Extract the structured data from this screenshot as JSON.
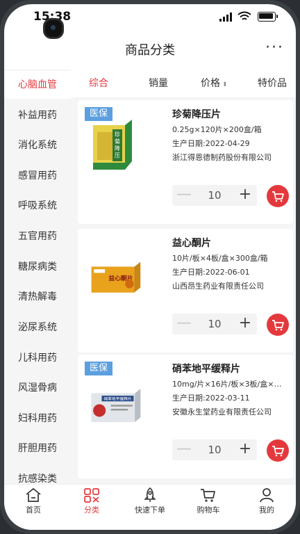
{
  "status_bar": {
    "time": "15:38"
  },
  "header": {
    "title": "商品分类",
    "more_label": "···"
  },
  "sidebar": {
    "items": [
      {
        "label": "心脑血管",
        "active": true
      },
      {
        "label": "补益用药"
      },
      {
        "label": "消化系统"
      },
      {
        "label": "感冒用药"
      },
      {
        "label": "呼吸系统"
      },
      {
        "label": "五官用药"
      },
      {
        "label": "糖尿病类"
      },
      {
        "label": "清热解毒"
      },
      {
        "label": "泌尿系统"
      },
      {
        "label": "儿科用药"
      },
      {
        "label": "风湿骨病"
      },
      {
        "label": "妇科用药"
      },
      {
        "label": "肝胆用药"
      },
      {
        "label": "抗感染类"
      }
    ]
  },
  "sort_bar": {
    "comprehensive": "综合",
    "sales": "销量",
    "price": "价格",
    "price_arrows": "⬍",
    "special": "特价品"
  },
  "products": [
    {
      "tag": "医保",
      "name": "珍菊降压片",
      "spec": "0.25g×120片×200盒/箱",
      "date": "生产日期:2022-04-29",
      "maker": "浙江得恩德制药股份有限公司",
      "qty": "10",
      "box_text": "珍菊降压片",
      "box_color": "#e7d24a"
    },
    {
      "tag": "",
      "name": "益心酮片",
      "spec": "10片/板×4板/盒×300盒/箱",
      "date": "生产日期:2022-06-01",
      "maker": "山西昂生药业有限责任公司",
      "qty": "10",
      "box_text": "益心酮片",
      "box_color": "#e8a21c"
    },
    {
      "tag": "医保",
      "name": "硝苯地平缓释片",
      "spec": "10mg/片×16片/板×3板/盒×3...",
      "date": "生产日期:2022-03-11",
      "maker": "安徽永生堂药业有限责任公司",
      "qty": "10",
      "box_text": "硝苯地平缓释片",
      "box_color": "#d9dde3"
    }
  ],
  "stepper": {
    "minus": "—",
    "plus": "+"
  },
  "tabbar": {
    "items": [
      {
        "label": "首页",
        "icon": "home-icon"
      },
      {
        "label": "分类",
        "icon": "category-icon",
        "active": true
      },
      {
        "label": "快速下单",
        "icon": "rocket-icon"
      },
      {
        "label": "购物车",
        "icon": "cart-icon"
      },
      {
        "label": "我的",
        "icon": "user-icon"
      }
    ]
  },
  "colors": {
    "accent": "#e4393c",
    "tag_blue": "#5b9fe0",
    "sidebar_bg": "#f5f5f5"
  }
}
